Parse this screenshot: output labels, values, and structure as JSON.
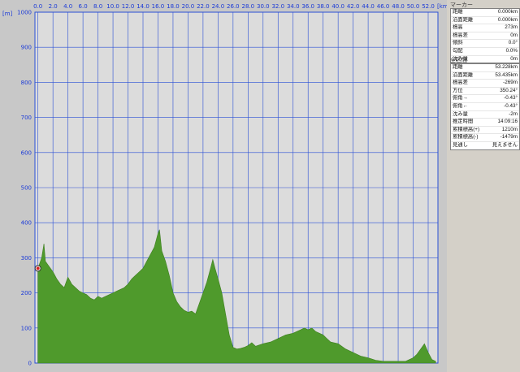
{
  "chart_data": {
    "type": "area",
    "xunit": "[km]",
    "yunit": "[m]",
    "xlim": [
      -0.4,
      53.3
    ],
    "ylim": [
      0,
      1000
    ],
    "xticks": [
      "0.0",
      "2.0",
      "4.0",
      "6.0",
      "8.0",
      "10.0",
      "12.0",
      "14.0",
      "16.0",
      "18.0",
      "20.0",
      "22.0",
      "24.0",
      "26.0",
      "28.0",
      "30.0",
      "32.0",
      "34.0",
      "36.0",
      "38.0",
      "40.0",
      "42.0",
      "44.0",
      "46.0",
      "48.0",
      "50.0",
      "52.0"
    ],
    "yticks": [
      "0",
      "100",
      "200",
      "300",
      "400",
      "500",
      "600",
      "700",
      "800",
      "900",
      "1000"
    ],
    "fill_color": "#4f9a2c",
    "grid_color": "#2a4fd6",
    "x": [
      0.0,
      0.5,
      0.8,
      1.0,
      1.5,
      2.0,
      2.5,
      3.0,
      3.5,
      4.0,
      4.5,
      5.0,
      5.5,
      6.0,
      6.5,
      7.0,
      7.5,
      8.0,
      8.5,
      9.0,
      9.5,
      10.0,
      10.5,
      11.0,
      11.5,
      12.0,
      12.5,
      13.0,
      13.5,
      14.0,
      14.5,
      15.0,
      15.5,
      16.0,
      16.2,
      16.5,
      17.0,
      17.5,
      18.0,
      18.5,
      19.0,
      19.5,
      20.0,
      20.5,
      21.0,
      21.5,
      22.0,
      22.5,
      23.0,
      23.3,
      23.6,
      24.0,
      24.5,
      25.0,
      25.5,
      26.0,
      26.5,
      27.0,
      27.5,
      28.0,
      28.5,
      29.0,
      30.0,
      31.0,
      32.0,
      33.0,
      34.0,
      35.0,
      35.5,
      36.0,
      36.5,
      37.0,
      37.5,
      38.0,
      38.5,
      39.0,
      40.0,
      41.0,
      42.0,
      43.0,
      44.0,
      45.0,
      46.0,
      47.0,
      48.0,
      49.0,
      50.0,
      50.5,
      51.0,
      51.5,
      52.0,
      52.5,
      53.0
    ],
    "y": [
      270,
      300,
      340,
      290,
      275,
      260,
      240,
      225,
      215,
      245,
      225,
      215,
      205,
      200,
      195,
      185,
      180,
      190,
      185,
      190,
      195,
      200,
      205,
      210,
      215,
      225,
      240,
      250,
      260,
      270,
      290,
      310,
      330,
      370,
      380,
      320,
      290,
      250,
      200,
      175,
      160,
      150,
      145,
      148,
      140,
      170,
      200,
      230,
      270,
      295,
      270,
      240,
      200,
      140,
      80,
      45,
      40,
      42,
      45,
      50,
      58,
      48,
      55,
      60,
      70,
      80,
      85,
      95,
      100,
      95,
      100,
      90,
      85,
      80,
      70,
      60,
      55,
      40,
      30,
      20,
      15,
      8,
      5,
      5,
      5,
      5,
      15,
      25,
      40,
      55,
      30,
      10,
      5
    ],
    "marker": {
      "x": 0.0,
      "y": 270
    }
  },
  "panel": {
    "marker": {
      "title": "マーカー",
      "rows": [
        {
          "label": "距離",
          "value": "0.000km"
        },
        {
          "label": "沿面距離",
          "value": "0.000km"
        },
        {
          "label": "標高",
          "value": "273m"
        },
        {
          "label": "標高差",
          "value": "0m"
        },
        {
          "label": "傾斜",
          "value": "0.0°"
        },
        {
          "label": "勾配",
          "value": "0.0%"
        },
        {
          "label": "沈み量",
          "value": "0m"
        }
      ]
    },
    "overall": {
      "title": "全区間",
      "rows": [
        {
          "label": "距離",
          "value": "53.228km"
        },
        {
          "label": "沿面距離",
          "value": "53.435km"
        },
        {
          "label": "標高差",
          "value": "-269m"
        },
        {
          "label": "方位",
          "value": "350.24°"
        },
        {
          "label": "俯角→",
          "value": "-0.43°"
        },
        {
          "label": "俯角←",
          "value": "-0.43°"
        },
        {
          "label": "沈み量",
          "value": "-2m"
        },
        {
          "label": "推定時間",
          "value": "14:09:16"
        },
        {
          "label": "累積標高(+)",
          "value": "1210m"
        },
        {
          "label": "累積標高(-)",
          "value": "-1479m"
        },
        {
          "label": "見通し",
          "value": "見えません"
        }
      ]
    }
  }
}
